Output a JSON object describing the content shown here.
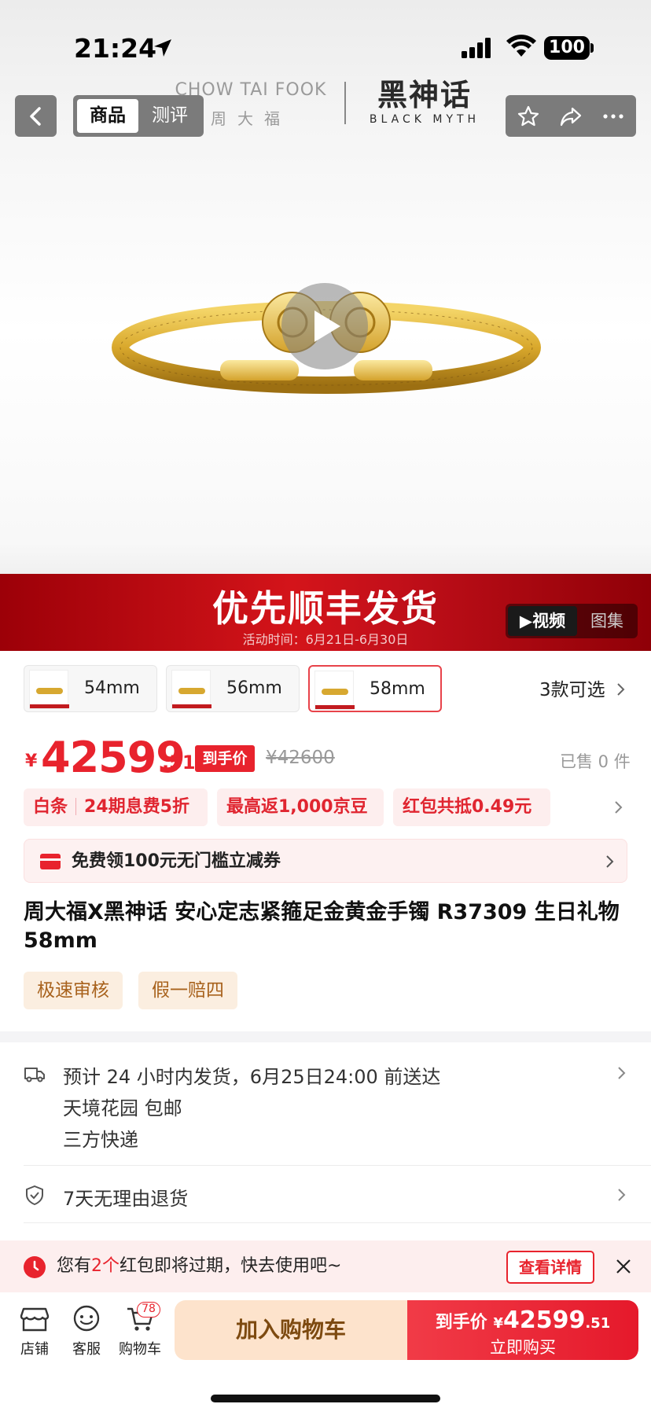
{
  "status": {
    "time": "21:24",
    "battery": "100"
  },
  "nav": {
    "tabs": [
      "商品",
      "测评"
    ],
    "brand_left_logo_cn": "CHOW TAI FOOK",
    "brand_left_logo_sub": "周大福",
    "brand_right_logo": "黑神话",
    "brand_right_sub": "BLACK MYTH"
  },
  "promo": {
    "title": "优先顺丰发货",
    "subtitle": "活动时间：6月21日-6月30日",
    "media_tabs": [
      "▶视频",
      "图集"
    ]
  },
  "skus": [
    {
      "label": "54mm",
      "selected": false
    },
    {
      "label": "56mm",
      "selected": false
    },
    {
      "label": "58mm",
      "selected": true
    }
  ],
  "sku_more": "3款可选",
  "price": {
    "currency": "¥",
    "integer": "42599",
    "decimal": ".51",
    "tag": "到手价",
    "original": "¥42600",
    "sold": "已售 0 件"
  },
  "chips": {
    "baitiao_a": "白条",
    "baitiao_b": "24期息费5折",
    "jingdou": "最高返1,000京豆",
    "hongbao": "红包共抵0.49元"
  },
  "coupon": {
    "text": "免费领100元无门槛立减券"
  },
  "product_title": "周大福X黑神话 安心定志紧箍足金黄金手镯 R37309 生日礼物 58mm",
  "tags": [
    "极速审核",
    "假一赔四"
  ],
  "shipping": {
    "line1": "预计 24 小时内发货，6月25日24:00 前送达",
    "line2": "天境花园  包邮",
    "line3": "三方快递"
  },
  "returns": {
    "text": "7天无理由退货"
  },
  "redpacket": {
    "pre": "您有",
    "count": "2个",
    "post": "红包即将过期，快去使用吧~",
    "button": "查看详情"
  },
  "bottom": {
    "shop": "店铺",
    "service": "客服",
    "cart": "购物车",
    "cart_count": "78",
    "add_cart": "加入购物车",
    "buy_label": "到手价",
    "buy_currency": "¥",
    "buy_int": "42599",
    "buy_dec": ".51",
    "buy_now": "立即购买"
  },
  "colors": {
    "accent": "#e8232d",
    "banner": "#c3101a",
    "tag_bg": "#fbeee0",
    "add_cart_bg": "#fde3cc"
  }
}
